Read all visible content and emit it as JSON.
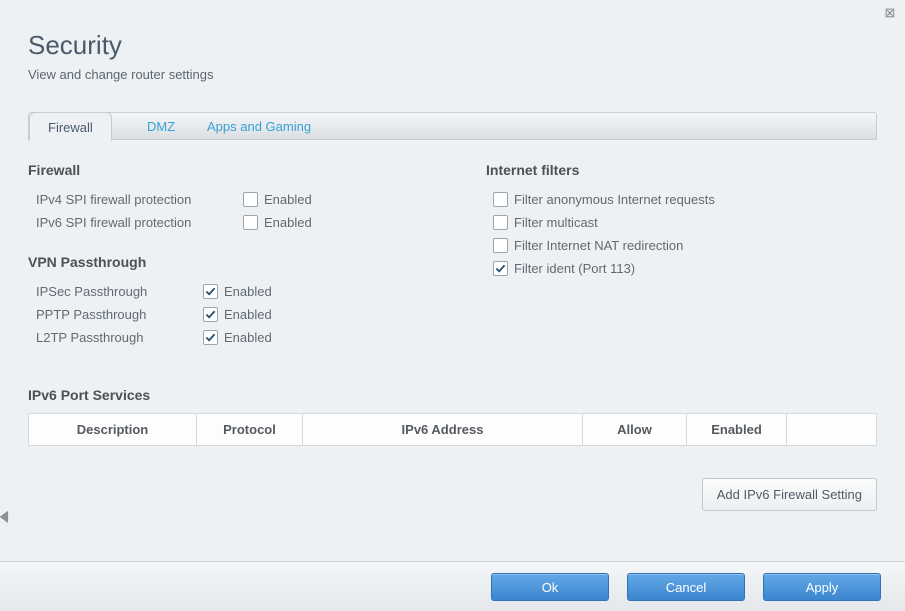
{
  "close_symbol": "⊠",
  "page": {
    "title": "Security",
    "subtitle": "View and change router settings"
  },
  "tabs": {
    "firewall": "Firewall",
    "dmz": "DMZ",
    "apps": "Apps and Gaming"
  },
  "firewall": {
    "heading": "Firewall",
    "ipv4_label": "IPv4 SPI firewall protection",
    "ipv4_enabled_text": "Enabled",
    "ipv6_label": "IPv6 SPI firewall protection",
    "ipv6_enabled_text": "Enabled"
  },
  "vpn": {
    "heading": "VPN Passthrough",
    "ipsec_label": "IPSec Passthrough",
    "ipsec_text": "Enabled",
    "pptp_label": "PPTP Passthrough",
    "pptp_text": "Enabled",
    "l2tp_label": "L2TP Passthrough",
    "l2tp_text": "Enabled"
  },
  "filters": {
    "heading": "Internet filters",
    "anon": "Filter anonymous Internet requests",
    "multicast": "Filter multicast",
    "nat": "Filter Internet NAT redirection",
    "ident": "Filter ident (Port 113)"
  },
  "ipv6_services": {
    "heading": "IPv6 Port Services",
    "cols": {
      "desc": "Description",
      "proto": "Protocol",
      "addr": "IPv6 Address",
      "allow": "Allow",
      "enabled": "Enabled"
    },
    "add_button": "Add IPv6 Firewall Setting"
  },
  "buttons": {
    "ok": "Ok",
    "cancel": "Cancel",
    "apply": "Apply"
  }
}
